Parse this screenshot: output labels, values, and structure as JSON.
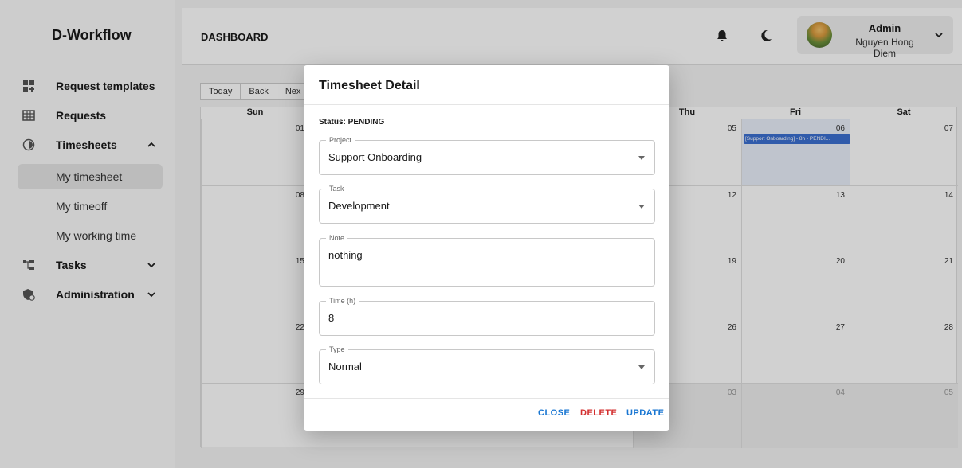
{
  "app": {
    "brand": "D-Workflow"
  },
  "sidebar": {
    "items": [
      {
        "label": "Request templates",
        "icon": "grid-plus-icon"
      },
      {
        "label": "Requests",
        "icon": "table-icon"
      },
      {
        "label": "Timesheets",
        "icon": "clock-circle-icon"
      },
      {
        "label": "Tasks",
        "icon": "tasks-icon"
      },
      {
        "label": "Administration",
        "icon": "admin-shield-icon"
      }
    ],
    "subitems": [
      {
        "label": "My timesheet"
      },
      {
        "label": "My timeoff"
      },
      {
        "label": "My working time"
      }
    ]
  },
  "header": {
    "title": "DASHBOARD",
    "user": {
      "role": "Admin",
      "name": "Nguyen Hong Diem"
    }
  },
  "calendar": {
    "toolbar": [
      "Today",
      "Back",
      "Nex"
    ],
    "days": [
      "Sun",
      "Thu",
      "Fri",
      "Sat"
    ],
    "weeks": [
      {
        "sun": "01",
        "thu": "05",
        "fri": "06",
        "sat": "07"
      },
      {
        "sun": "08",
        "thu": "12",
        "fri": "13",
        "sat": "14"
      },
      {
        "sun": "15",
        "thu": "19",
        "fri": "20",
        "sat": "21"
      },
      {
        "sun": "22",
        "thu": "26",
        "fri": "27",
        "sat": "28"
      },
      {
        "sun": "29",
        "thu": "03",
        "fri": "04",
        "sat": "05"
      }
    ],
    "event": "[Support Onboarding] - 8h - PENDI..."
  },
  "dialog": {
    "title": "Timesheet Detail",
    "status_label": "Status: PENDING",
    "fields": {
      "project": {
        "label": "Project",
        "value": "Support Onboarding"
      },
      "task": {
        "label": "Task",
        "value": "Development"
      },
      "note": {
        "label": "Note",
        "value": "nothing"
      },
      "time": {
        "label": "Time (h)",
        "value": "8"
      },
      "type": {
        "label": "Type",
        "value": "Normal"
      }
    },
    "actions": {
      "close": "CLOSE",
      "delete": "DELETE",
      "update": "UPDATE"
    }
  },
  "colors": {
    "primary": "#1976d2",
    "danger": "#d32f2f",
    "event": "#3b6fd1"
  }
}
